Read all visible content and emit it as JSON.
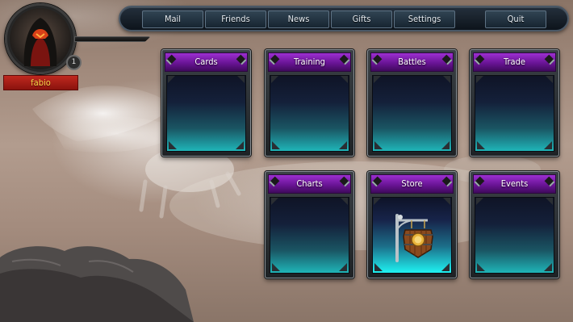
{
  "menu": {
    "mail": "Mail",
    "friends": "Friends",
    "news": "News",
    "gifts": "Gifts",
    "settings": "Settings",
    "quit": "Quit"
  },
  "player": {
    "name": "fabio",
    "level": "1",
    "avatar_icon": "hooded-figure-icon"
  },
  "cards": {
    "cards": "Cards",
    "training": "Training",
    "battles": "Battles",
    "trade": "Trade",
    "charts": "Charts",
    "store": "Store",
    "events": "Events"
  },
  "icons": {
    "store": "store-sign-icon"
  },
  "colors": {
    "card_header": "#6a1496",
    "card_glow": "#1fb5b8",
    "name_plate": "#b0241b",
    "name_text": "#ffd84a"
  }
}
